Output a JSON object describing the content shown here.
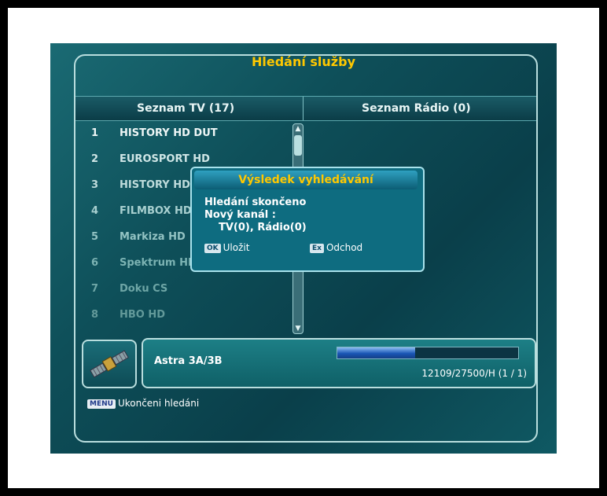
{
  "screen": {
    "title": "Hledání služby",
    "tv_list_header": "Seznam TV (17)",
    "radio_list_header": "Seznam Rádio (0)",
    "channels": [
      {
        "num": "1",
        "name": "HISTORY HD DUT"
      },
      {
        "num": "2",
        "name": "EUROSPORT HD"
      },
      {
        "num": "3",
        "name": "HISTORY HD"
      },
      {
        "num": "4",
        "name": "FILMBOX HD"
      },
      {
        "num": "5",
        "name": "Markiza HD"
      },
      {
        "num": "6",
        "name": "Spektrum HD"
      },
      {
        "num": "7",
        "name": "Doku CS"
      },
      {
        "num": "8",
        "name": "HBO HD"
      }
    ]
  },
  "dialog": {
    "title": "Výsledek vyhledávání",
    "line1": "Hledání skončeno",
    "line2": "Nový kanál :",
    "line3": "TV(0), Rádio(0)",
    "ok_key": "OK",
    "ok_label": "Uložit",
    "ex_key": "Ex",
    "ex_label": "Odchod"
  },
  "satellite": {
    "name": "Astra 3A/3B",
    "transponder": "12109/27500/H (1 / 1)",
    "progress": 0.43,
    "icon": "satellite-icon"
  },
  "footer": {
    "menu_key": "MENU",
    "label": "Ukončeni hledáni"
  },
  "colors": {
    "title": "#ffc800",
    "dialog_bg": "#0e6c80",
    "panel_border": "#b9dede"
  }
}
